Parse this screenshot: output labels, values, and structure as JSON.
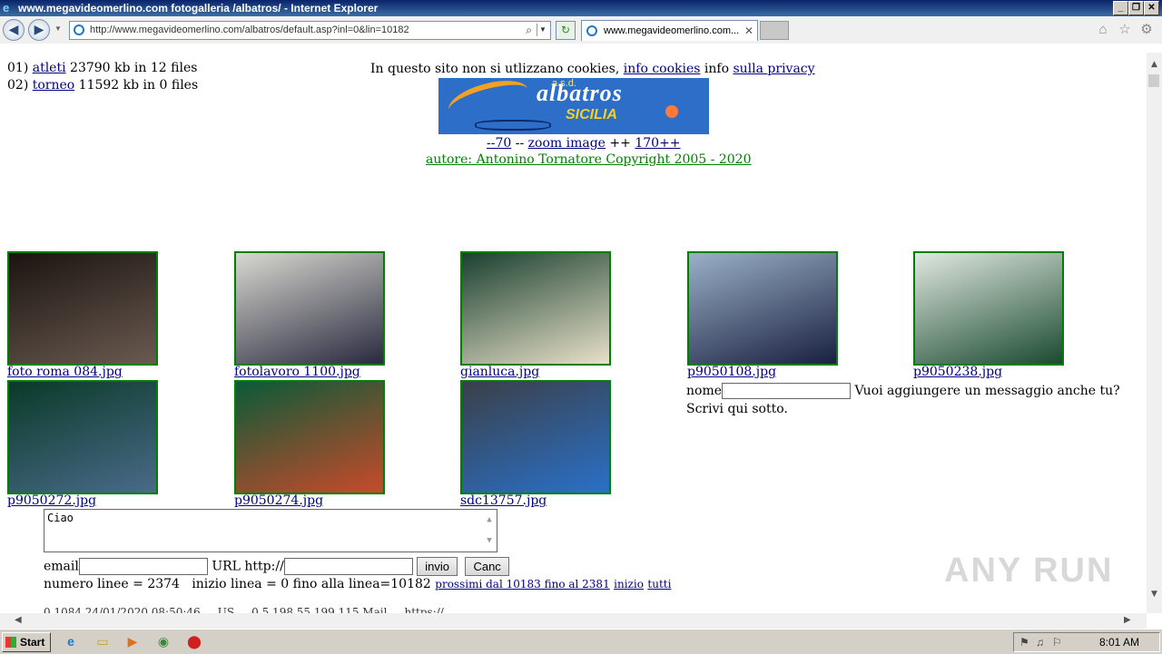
{
  "window": {
    "title": "www.megavideomerlino.com fotogalleria /albatros/ - Internet Explorer"
  },
  "browser": {
    "url": "http://www.megavideomerlino.com/albatros/default.asp?inl=0&lin=10182",
    "tab_title": "www.megavideomerlino.com...",
    "icons": [
      "back-icon",
      "forward-icon",
      "home-icon",
      "favorites-star-icon",
      "tools-gear-icon"
    ]
  },
  "files": [
    {
      "num": "01)",
      "name": "atleti",
      "info": "23790 kb in 12 files"
    },
    {
      "num": "02)",
      "name": "torneo",
      "info": "11592 kb in 0 files"
    }
  ],
  "notice": {
    "text": "In questo sito non si utlizzano cookies,",
    "link1": "info cookies",
    "middle": "info",
    "link2": "sulla privacy"
  },
  "banner": {
    "small": "a.s.d.",
    "big": "albatros",
    "sub": "SICILIA"
  },
  "zoom": {
    "minus": "--70",
    "sep1": "--",
    "label": "zoom image",
    "sep2": "++",
    "plus": "170++"
  },
  "author": "autore: Antonino Tornatore Copyright 2005 - 2020",
  "photos": [
    {
      "caption": "foto roma 084.jpg",
      "c1": "#1a1410",
      "c2": "#6a5a50"
    },
    {
      "caption": "fotolavoro 1100.jpg",
      "c1": "#d8d8d0",
      "c2": "#2a2a40"
    },
    {
      "caption": "gianluca.jpg",
      "c1": "#1a4030",
      "c2": "#e8e0c8"
    },
    {
      "caption": "p9050108.jpg",
      "c1": "#9ab0c8",
      "c2": "#1a2040"
    },
    {
      "caption": "p9050238.jpg",
      "c1": "#e0e8e0",
      "c2": "#1a4a30"
    },
    {
      "caption": "p9050272.jpg",
      "c1": "#0a3a28",
      "c2": "#4a6a8a"
    },
    {
      "caption": "p9050274.jpg",
      "c1": "#0a5a38",
      "c2": "#c84a2a"
    },
    {
      "caption": "sdc13757.jpg",
      "c1": "#3a4048",
      "c2": "#2a70c8"
    }
  ],
  "form": {
    "name_label": "nome",
    "prompt": "Vuoi aggiungere un messaggio anche tu? Scrivi qui sotto.",
    "message": "Ciao",
    "email_label": "email",
    "url_label": "URL http://",
    "submit": "invio",
    "cancel": "Canc"
  },
  "stats": {
    "text": "numero linee = 2374   inizio linea = 0 fino alla linea=10182",
    "next": "prossimi dal 10183 fino al 2381",
    "start": "inizio",
    "all": "tutti"
  },
  "cutoff_text": "0,1084 24/01/2020 08:50:46 ... US ... 0.5.198.55.199.115 Mail ... https://...",
  "watermark": "ANY RUN",
  "taskbar": {
    "start": "Start",
    "clock": "8:01 AM"
  }
}
